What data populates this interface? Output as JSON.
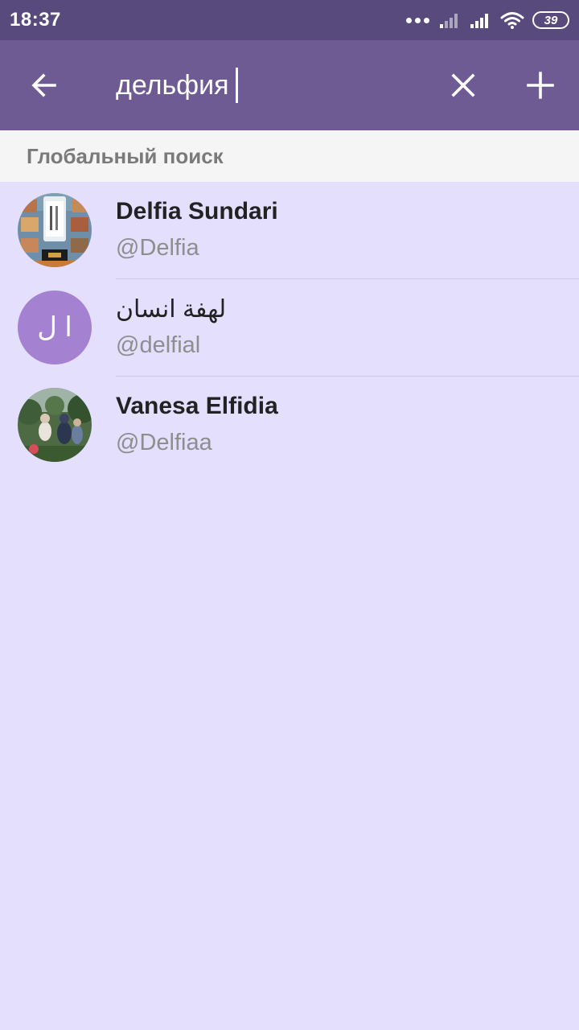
{
  "status_bar": {
    "time": "18:37",
    "battery": "39",
    "icons": [
      "more-dots-icon",
      "signal-weak-icon",
      "signal-icon",
      "wifi-icon",
      "battery-icon"
    ]
  },
  "toolbar": {
    "search_value": "дельфия",
    "back_icon": "arrow-left-icon",
    "clear_icon": "close-icon",
    "add_icon": "plus-icon"
  },
  "section": {
    "title": "Глобальный поиск"
  },
  "results": [
    {
      "name": "Delfia Sundari",
      "username": "@Delfia",
      "avatar": "photo"
    },
    {
      "name": "لهفة انسان",
      "username": "@delfial",
      "avatar": "initials",
      "initials": "ا ل",
      "avatar_color": "#a582d1"
    },
    {
      "name": "Vanesa Elfidia",
      "username": "@Delfiaa",
      "avatar": "photo"
    }
  ],
  "colors": {
    "status_bar": "#594a7d",
    "toolbar": "#6e5b93",
    "list_background": "#e3dffd",
    "section_background": "#f5f5f5"
  }
}
